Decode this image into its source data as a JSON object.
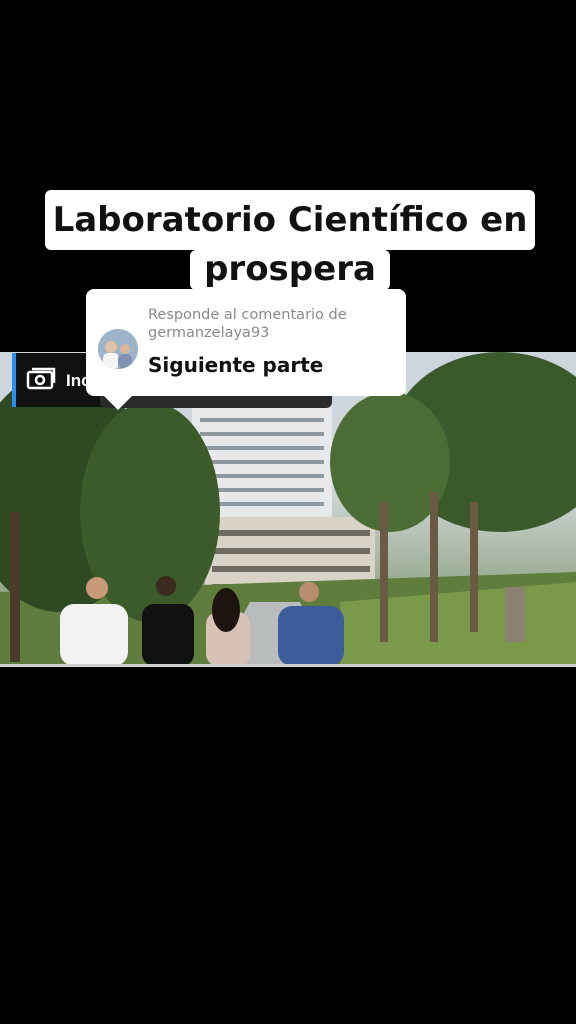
{
  "caption": {
    "line1": "Laboratorio Científico en",
    "line2": "prospera"
  },
  "reply_card": {
    "prefix": "Responde al comentario de",
    "username": "germanzelaya93",
    "text": "Siguiente parte"
  },
  "banner": {
    "text": "Inc",
    "icon": "money-icon",
    "accent": "#2d8cf0"
  }
}
